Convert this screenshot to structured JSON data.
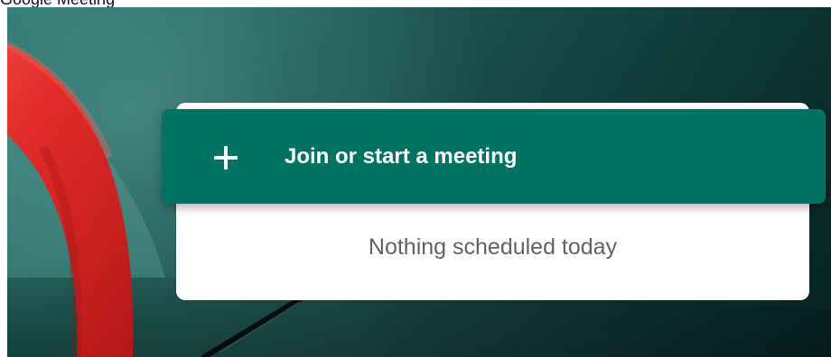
{
  "header": {
    "partial_caption": "Google Meeting"
  },
  "meeting": {
    "join_button_label": "Join or start a meeting",
    "join_icon": "plus-icon",
    "empty_schedule_text": "Nothing scheduled today"
  },
  "colors": {
    "primary_button": "#017362",
    "button_text": "#ffffff",
    "schedule_text": "#5f6368",
    "background_dark": "#0d3d3b",
    "accent_red": "#ef2c2c"
  }
}
